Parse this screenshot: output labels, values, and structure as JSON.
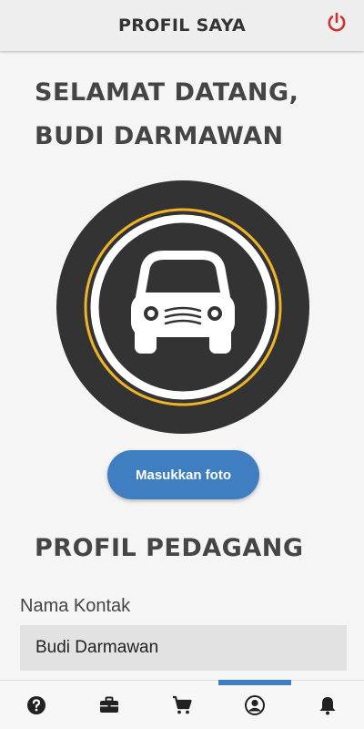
{
  "header": {
    "title": "PROFIL SAYA"
  },
  "welcome": {
    "line1": "SELAMAT DATANG,",
    "line2": "BUDI DARMAWAN"
  },
  "photo_button": {
    "label": "Masukkan foto"
  },
  "merchant_profile": {
    "title": "PROFIL PEDAGANG",
    "contact_name_label": "Nama Kontak",
    "contact_name_value": "Budi Darmawan"
  },
  "bottom_nav": {
    "items": [
      {
        "icon": "help-icon",
        "active": false
      },
      {
        "icon": "briefcase-icon",
        "active": false
      },
      {
        "icon": "cart-icon",
        "active": false
      },
      {
        "icon": "profile-icon",
        "active": true
      },
      {
        "icon": "bell-icon",
        "active": false
      }
    ]
  },
  "colors": {
    "accent": "#3f7fc1",
    "power": "#d32f2f",
    "ring": "#f0b429",
    "avatar_bg": "#333333"
  }
}
